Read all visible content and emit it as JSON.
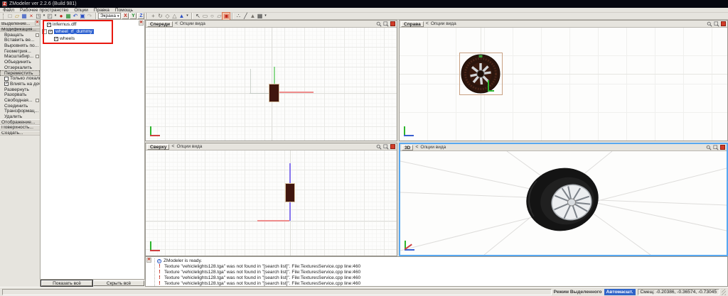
{
  "window": {
    "title": "ZModeler ver 2.2.6 (Build 981)",
    "icon_letter": "Z"
  },
  "menu": {
    "items": [
      "Файл",
      "Рабочее пространство",
      "Опции",
      "Правка",
      "Помощь"
    ]
  },
  "toolbar": {
    "space_combo": "Экрана",
    "drop_glyph": "▾",
    "group1": [
      {
        "name": "new-file-icon",
        "glyph": "□",
        "cls": "c-mid"
      },
      {
        "name": "open-file-icon",
        "glyph": "▱",
        "cls": "c-yellow"
      },
      {
        "name": "save-icon",
        "glyph": "▦",
        "cls": "c-blue"
      },
      {
        "name": "delete-icon",
        "glyph": "×",
        "cls": "c-red"
      },
      {
        "name": "import-icon",
        "glyph": "◳",
        "cls": "c-dark"
      },
      {
        "name": "dropdown-arrow-icon",
        "glyph": "▾",
        "cls": "drop"
      },
      {
        "name": "export-icon",
        "glyph": "◰",
        "cls": "c-dark"
      },
      {
        "name": "dropdown-arrow-icon",
        "glyph": "▾",
        "cls": "drop"
      },
      {
        "name": "material-sphere-icon",
        "glyph": "●",
        "cls": "c-red"
      },
      {
        "name": "texture-image-icon",
        "glyph": "▦",
        "cls": "c-green"
      },
      {
        "name": "undo-icon",
        "glyph": "↶",
        "cls": "c-blue"
      },
      {
        "name": "embed-script-icon",
        "glyph": "▣",
        "cls": "c-blue"
      },
      {
        "name": "redo-icon",
        "glyph": "↷",
        "cls": "disabled"
      }
    ],
    "axes": [
      {
        "name": "axis-x-button",
        "label": "X",
        "cls": "c-red"
      },
      {
        "name": "axis-y-button",
        "label": "Y",
        "cls": "c-green"
      },
      {
        "name": "axis-z-button",
        "label": "Z",
        "cls": "c-blue"
      }
    ],
    "group2": [
      {
        "name": "move-gizmo-icon",
        "glyph": "+",
        "cls": "c-mid"
      },
      {
        "name": "rotate-gizmo-icon",
        "glyph": "↻",
        "cls": "c-mid"
      },
      {
        "name": "scale-gizmo-icon",
        "glyph": "◇",
        "cls": "c-mid"
      },
      {
        "name": "snap-gizmo-icon",
        "glyph": "△",
        "cls": "c-mid"
      },
      {
        "name": "pivot-cone-icon",
        "glyph": "▲",
        "cls": "c-blue"
      },
      {
        "name": "dropdown-arrow-icon",
        "glyph": "▾",
        "cls": "drop"
      }
    ],
    "group3": [
      {
        "name": "select-single-icon",
        "glyph": "↖",
        "cls": "c-dark"
      },
      {
        "name": "select-quad-icon",
        "glyph": "▭",
        "cls": "c-mid"
      },
      {
        "name": "select-circle-icon",
        "glyph": "○",
        "cls": "c-mid"
      },
      {
        "name": "select-poly-icon",
        "glyph": "▱",
        "cls": "c-mid"
      },
      {
        "name": "select-box-icon",
        "glyph": "▣",
        "cls": "c-red active"
      }
    ],
    "group4": [
      {
        "name": "vertices-mode-icon",
        "glyph": "∴",
        "cls": "c-dark"
      },
      {
        "name": "edges-mode-icon",
        "glyph": "╱",
        "cls": "c-dark"
      },
      {
        "name": "faces-mode-icon",
        "glyph": "▲",
        "cls": "c-mid"
      },
      {
        "name": "objects-mode-icon",
        "glyph": "▦",
        "cls": "c-dark"
      },
      {
        "name": "dropdown-arrow-icon",
        "glyph": "▾",
        "cls": "drop"
      }
    ]
  },
  "sidebar": {
    "items": [
      {
        "name": "sidebar-item-select",
        "label": "Выделение...",
        "type": "section"
      },
      {
        "name": "sidebar-item-modify",
        "label": "Модификация...",
        "type": "section-active"
      },
      {
        "name": "sidebar-item-rotate",
        "label": "Вращать",
        "type": "item has-box"
      },
      {
        "name": "sidebar-item-insert-vertex",
        "label": "Вставить ве...",
        "type": "item"
      },
      {
        "name": "sidebar-item-align",
        "label": "Выровнять по...",
        "type": "item"
      },
      {
        "name": "sidebar-item-geometry",
        "label": "Геометрия...",
        "type": "item"
      },
      {
        "name": "sidebar-item-scale",
        "label": "Масштабир...",
        "type": "item has-box"
      },
      {
        "name": "sidebar-item-unite",
        "label": "Объединить",
        "type": "item"
      },
      {
        "name": "sidebar-item-mirror",
        "label": "Отзеркалить",
        "type": "item"
      },
      {
        "name": "sidebar-item-move",
        "label": "Переместить",
        "type": "item-selected"
      },
      {
        "name": "sidebar-check-local-only",
        "label": "Только локальн.",
        "type": "check"
      },
      {
        "name": "sidebar-check-affect-children",
        "label": "Влиять на дочерн.",
        "type": "check-checked"
      },
      {
        "name": "sidebar-item-unwrap",
        "label": "Развернуть",
        "type": "item"
      },
      {
        "name": "sidebar-item-detach",
        "label": "Разорвать",
        "type": "item"
      },
      {
        "name": "sidebar-item-free",
        "label": "Свободная...",
        "type": "item has-box"
      },
      {
        "name": "sidebar-item-attach",
        "label": "Соединить",
        "type": "item"
      },
      {
        "name": "sidebar-item-transform",
        "label": "Трансформац...",
        "type": "item"
      },
      {
        "name": "sidebar-item-delete",
        "label": "Удалить",
        "type": "item"
      },
      {
        "name": "sidebar-item-display",
        "label": "Отображение...",
        "type": "section"
      },
      {
        "name": "sidebar-item-surface",
        "label": "Поверхность...",
        "type": "section"
      },
      {
        "name": "sidebar-item-create",
        "label": "Создать...",
        "type": "section"
      }
    ]
  },
  "scene_tree": {
    "items": [
      {
        "label": "infernus.dff"
      },
      {
        "label": "wheel_rf_dummy"
      },
      {
        "label": "wheels"
      }
    ],
    "show_all": "Показать всё",
    "hide_all": "Скрыть всё"
  },
  "viewports": {
    "options_label": "Опции вида",
    "collapse_glyph": "<",
    "front": {
      "label": "Спереди"
    },
    "right": {
      "label": "Справа"
    },
    "top": {
      "label": "Сверху"
    },
    "persp": {
      "label": "3D"
    }
  },
  "log": {
    "lines": [
      {
        "type": "info",
        "icon": "i",
        "text": "ZModeler is ready."
      },
      {
        "type": "warn",
        "icon": "!",
        "text": "Texture \"vehiclelights128.tga\" was not found in \"[search list]\". File:TexturesService.cpp line:460"
      },
      {
        "type": "warn",
        "icon": "!",
        "text": "Texture \"vehiclelights128.tga\" was not found in \"[search list]\". File:TexturesService.cpp line:460"
      },
      {
        "type": "warn",
        "icon": "!",
        "text": "Texture \"vehiclelights128.tga\" was not found in \"[search list]\". File:TexturesService.cpp line:460"
      },
      {
        "type": "warn",
        "icon": "!",
        "text": "Texture \"vehiclelights128.tga\" was not found in \"[search list]\". File:TexturesService.cpp line:460"
      }
    ]
  },
  "statusbar": {
    "mode_label": "Режим Выделенного",
    "autoscale_label": "Автомасшт.",
    "offset_label": "Смещ: -0.20386, -0.36574, -0.73045"
  },
  "colors": {
    "selection_blue": "#2a5fd0",
    "annotation_red": "#e8180f",
    "active_viewport_border": "#58a8f0"
  }
}
